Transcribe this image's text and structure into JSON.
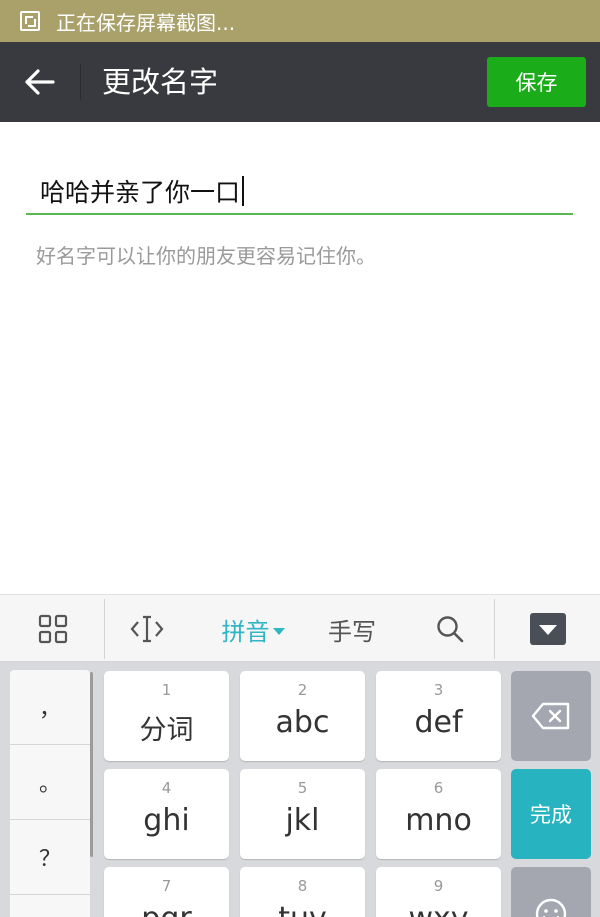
{
  "status_bar": {
    "text": "正在保存屏幕截图...",
    "icon": "screenshot-icon"
  },
  "action_bar": {
    "back_icon": "back-arrow-icon",
    "title": "更改名字",
    "save_label": "保存",
    "save_color": "#1aad19",
    "bar_color": "#393a3f"
  },
  "form": {
    "name_value": "哈哈并亲了你一口",
    "hint": "好名字可以让你的朋友更容易记住你。",
    "accent_color": "#58b952"
  },
  "ime_toolbar": {
    "grid_icon": "grid-icon",
    "cursor_icon": "cursor-move-icon",
    "pinyin_label": "拼音",
    "handwrite_label": "手写",
    "search_icon": "search-icon",
    "hide_icon": "hide-keyboard-icon"
  },
  "keyboard": {
    "punctuation": [
      "，",
      "。",
      "？"
    ],
    "keys": [
      {
        "num": "1",
        "label": "分词"
      },
      {
        "num": "2",
        "label": "abc"
      },
      {
        "num": "3",
        "label": "def"
      },
      {
        "num": "4",
        "label": "ghi"
      },
      {
        "num": "5",
        "label": "jkl"
      },
      {
        "num": "6",
        "label": "mno"
      },
      {
        "num": "7",
        "label": "pqr"
      },
      {
        "num": "8",
        "label": "tuv"
      },
      {
        "num": "9",
        "label": "wxy"
      }
    ],
    "delete_icon": "backspace-icon",
    "done_label": "完成",
    "emoji_icon": "emoji-icon",
    "done_color": "#27b3bf"
  }
}
